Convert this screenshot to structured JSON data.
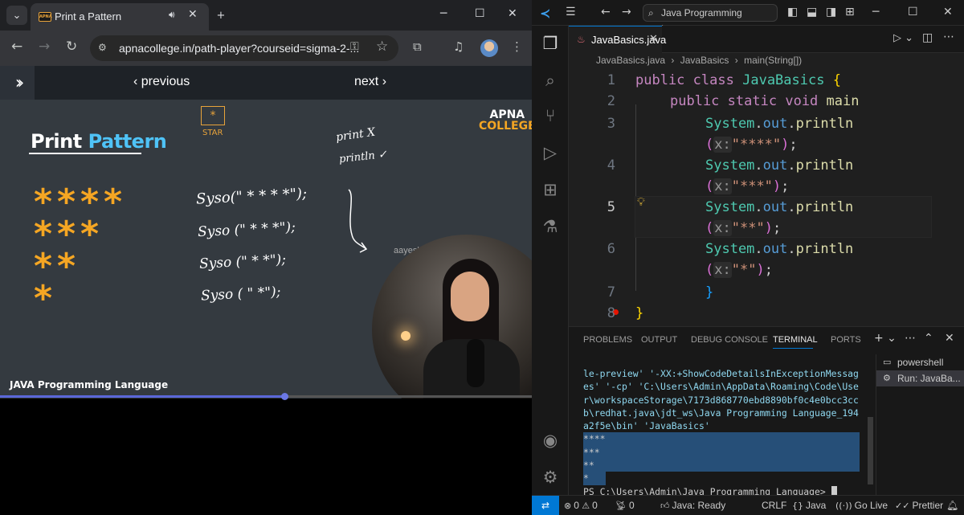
{
  "browser": {
    "tab_title": "Print a Pattern",
    "url": "apnacollege.in/path-player?courseid=sigma-2-...",
    "player": {
      "previous": "‹ previous",
      "next": "next ›"
    },
    "video": {
      "slide_title_a": "Print ",
      "slide_title_b": "Pattern",
      "logo_line1": "APNA",
      "logo_line2": "COLLEGE",
      "star_box": "*",
      "star_label": "STAR",
      "star_rows": [
        "****",
        "***",
        "**",
        "*"
      ],
      "code_lines": [
        "Syso(\" * * * *\");",
        "Syso (\" * * *\");",
        "Syso (\" * *\");",
        "Syso ( \" *\");"
      ],
      "note1": "print X",
      "note2": "println ✓",
      "watermark": "aayeshaquazi04@gmail.com",
      "caption": "JAVA Programming Language",
      "progress": 0.534
    }
  },
  "vscode": {
    "command_center": "Java Programming Language",
    "tab_filename": "JavaBasics.java",
    "breadcrumbs": [
      "JavaBasics.java",
      "›",
      "JavaBasics",
      "›",
      "main(String[])"
    ],
    "line_numbers": [
      "1",
      "2",
      "3",
      "",
      "4",
      "",
      "5",
      "",
      "6",
      "",
      "7",
      "8"
    ],
    "code": {
      "l1_kw": "public",
      "l1_kw2": "class",
      "l1_cls": "JavaBasics",
      "l1_br": "{",
      "l2_kw": "public",
      "l2_kw2": "static",
      "l2_kw3": "void",
      "l2_fn": "main",
      "sys": "System",
      "out": "out",
      "println": "println",
      "hint": "x:",
      "strings": [
        "\"****\"",
        "\"***\"",
        "\"**\"",
        "\"*\""
      ],
      "close_inner": "}",
      "close_outer": "}"
    },
    "panel_tabs": [
      "PROBLEMS",
      "OUTPUT",
      "DEBUG CONSOLE",
      "TERMINAL",
      "PORTS"
    ],
    "terminal": {
      "command": "le-preview' '-XX:+ShowCodeDetailsInExceptionMessages' '-cp' 'C:\\Users\\Admin\\AppData\\Roaming\\Code\\User\\workspaceStorage\\7173d868770ebd8890bf0c4e0bcc3ccb\\redhat.java\\jdt_ws\\Java Programming Language_194a2f5e\\bin' 'JavaBasics'",
      "output": [
        "****",
        "***",
        "**",
        "*"
      ],
      "prompt": "PS C:\\Users\\Admin\\Java Programming Language> "
    },
    "terminal_list": [
      "powershell",
      "Run: JavaBa..."
    ],
    "status": {
      "errors": "0",
      "warnings": "0",
      "ports": "0",
      "java": "Java: Ready",
      "eol": "CRLF",
      "lang": "Java",
      "golive": "Go Live",
      "prettier": "Prettier"
    }
  }
}
